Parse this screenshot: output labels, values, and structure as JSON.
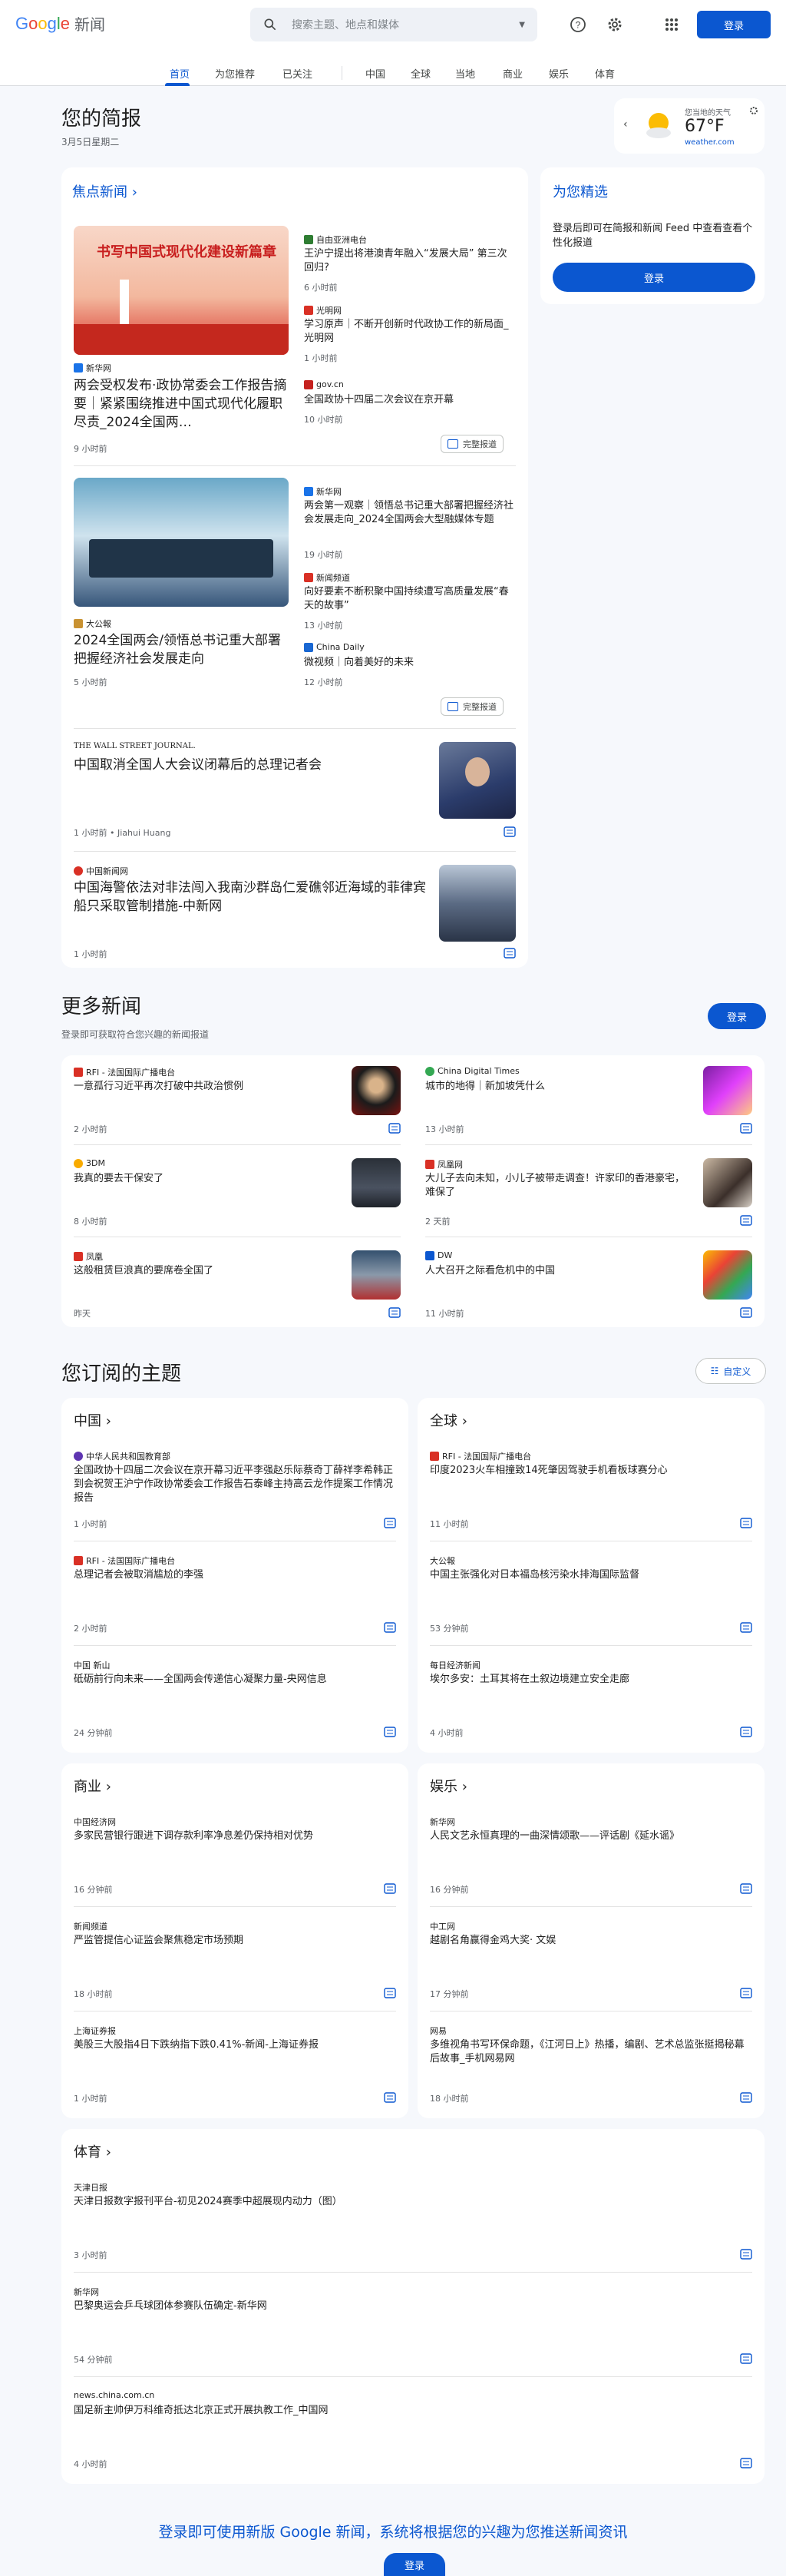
{
  "header": {
    "logo_google": "Google",
    "logo_news": "新闻",
    "search_placeholder": "搜索主题、地点和媒体",
    "login": "登录"
  },
  "nav": {
    "tabs": [
      "首页",
      "为您推荐",
      "已关注",
      "中国",
      "全球",
      "当地",
      "商业",
      "娱乐",
      "体育"
    ]
  },
  "brief": {
    "title": "您的简报",
    "date": "3月5日星期二"
  },
  "weather": {
    "label": "您当地的天气",
    "temp": "67°F",
    "source": "weather.com"
  },
  "headlines": {
    "title": "焦点新闻",
    "full_coverage": "完整报道",
    "cluster1": {
      "main": {
        "source": "新华网",
        "title": "两会受权发布·政协常委会工作报告摘要｜紧紧围绕推进中国式现代化履职尽责_2024全国两…",
        "time": "9 小时前",
        "image_text": "书写中国式现代化建设新篇章"
      },
      "side": [
        {
          "source": "自由亚洲电台",
          "title": "王沪宁提出将港澳青年融入“发展大局” 第三次回归?",
          "time": "6 小时前"
        },
        {
          "source": "光明网",
          "title": "学习原声｜不断开创新时代政协工作的新局面_光明网",
          "time": "1 小时前"
        },
        {
          "source": "gov.cn",
          "title": "全国政协十四届二次会议在京开幕",
          "time": "10 小时前"
        }
      ]
    },
    "cluster2": {
      "main": {
        "source": "大公報",
        "title": "2024全国两会/领悟总书记重大部署把握经济社会发展走向",
        "time": "5 小时前"
      },
      "side": [
        {
          "source": "新华网",
          "title": "两会第一观察｜领悟总书记重大部署把握经济社会发展走向_2024全国两会大型融媒体专题",
          "time": "19 小时前"
        },
        {
          "source": "新闻频道",
          "title": "向好要素不断积聚中国持续遭写高质量发展“春天的故事”",
          "time": "13 小时前"
        },
        {
          "source": "China Daily",
          "title": "微视频｜向着美好的未来",
          "time": "12 小时前"
        }
      ]
    },
    "single1": {
      "source": "THE WALL STREET JOURNAL.",
      "title": "中国取消全国人大会议闭幕后的总理记者会",
      "time": "1 小时前",
      "author": "Jiahui Huang"
    },
    "single2": {
      "source": "中国新闻网",
      "title": "中国海警依法对非法闯入我南沙群岛仁爱礁邻近海域的菲律宾船只采取管制措施-中新网",
      "time": "1 小时前"
    }
  },
  "picks": {
    "title": "为您精选",
    "desc": "登录后即可在简报和新闻 Feed 中查看查看个性化报道",
    "login": "登录"
  },
  "more": {
    "title": "更多新闻",
    "sub": "登录即可获取符合您兴趣的新闻报道",
    "login": "登录",
    "items": [
      {
        "source": "RFI - 法国国际广播电台",
        "title": "一意孤行习近平再次打破中共政治惯例",
        "time": "2 小时前"
      },
      {
        "source": "China Digital Times",
        "title": "城市的地得｜新加坡凭什么",
        "time": "13 小时前"
      },
      {
        "source": "3DM",
        "title": "我真的要去干保安了",
        "time": "8 小时前"
      },
      {
        "source": "凤凰网",
        "title": "大儿子去向未知，小儿子被带走调查！许家印的香港豪宅，难保了",
        "time": "2 天前"
      },
      {
        "source": "凤凰",
        "title": "这般租赁巨浪真的要席卷全国了",
        "time": "昨天"
      },
      {
        "source": "DW",
        "title": "人大召开之际看危机中的中国",
        "time": "11 小时前"
      }
    ]
  },
  "topics": {
    "title": "您订阅的主题",
    "customize": "自定义",
    "china": {
      "title": "中国",
      "items": [
        {
          "source": "中华人民共和国教育部",
          "title": "全国政协十四届二次会议在京开幕习近平李强赵乐际蔡奇丁薛祥李希韩正到会祝贺王沪宁作政协常委会工作报告石泰峰主持高云龙作提案工作情况报告",
          "time": "1 小时前"
        },
        {
          "source": "RFI - 法国国际广播电台",
          "title": "总理记者会被取消尴尬的李强",
          "time": "2 小时前"
        },
        {
          "source": "中国 新山",
          "title": "砥砺前行向未来——全国两会传递信心凝聚力量-央网信息",
          "time": "24 分钟前"
        }
      ]
    },
    "world": {
      "title": "全球",
      "items": [
        {
          "source": "RFI - 法国国际广播电台",
          "title": "印度2023火车相撞致14死肇因驾驶手机看板球赛分心",
          "time": "11 小时前"
        },
        {
          "source": "大公報",
          "title": "中国主张强化对日本福岛核污染水排海国际监督",
          "time": "53 分钟前"
        },
        {
          "source": "每日经济新闻",
          "title": "埃尔多安：土耳其将在土叙边境建立安全走廊",
          "time": "4 小时前"
        }
      ]
    },
    "business": {
      "title": "商业",
      "items": [
        {
          "source": "中国经济网",
          "title": "多家民营银行跟进下调存款利率净息差仍保持相对优势",
          "time": "16 分钟前"
        },
        {
          "source": "新闻频道",
          "title": "严监管提信心证监会聚焦稳定市场预期",
          "time": "18 小时前"
        },
        {
          "source": "上海证券报",
          "title": "美股三大股指4日下跌纳指下跌0.41%-新闻-上海证券报",
          "time": "1 小时前"
        }
      ]
    },
    "entertainment": {
      "title": "娱乐",
      "items": [
        {
          "source": "新华网",
          "title": "人民文艺永恒真理的一曲深情颂歌——评话剧《延水谣》",
          "time": "16 分钟前"
        },
        {
          "source": "中工网",
          "title": "越剧名角赢得金鸡大奖· 文娱",
          "time": "17 分钟前"
        },
        {
          "source": "网易",
          "title": "多维视角书写环保命题，《江河日上》热播，编剧、艺术总监张挺揭秘幕后故事_手机网易网",
          "time": "18 小时前"
        }
      ]
    },
    "sports": {
      "title": "体育",
      "items": [
        {
          "source": "天津日报",
          "title": "天津日报数字报刊平台-初见2024赛季中超展现内动力（图）",
          "time": "3 小时前"
        },
        {
          "source": "新华网",
          "title": "巴黎奥运会乒乓球团体参赛队伍确定-新华网",
          "time": "54 分钟前"
        },
        {
          "source": "news.china.com.cn",
          "title": "国足新主帅伊万科维奇抵达北京正式开展执教工作_中国网",
          "time": "4 小时前"
        }
      ]
    }
  },
  "footer": {
    "text": "登录即可使用新版 Google 新闻，系统将根据您的兴趣为您推送新闻资讯",
    "login": "登录"
  },
  "colors": {
    "accent": "#0b57d0",
    "google_blue": "#4285f4",
    "google_red": "#ea4335",
    "google_yellow": "#fbbc04",
    "google_green": "#34a853"
  }
}
